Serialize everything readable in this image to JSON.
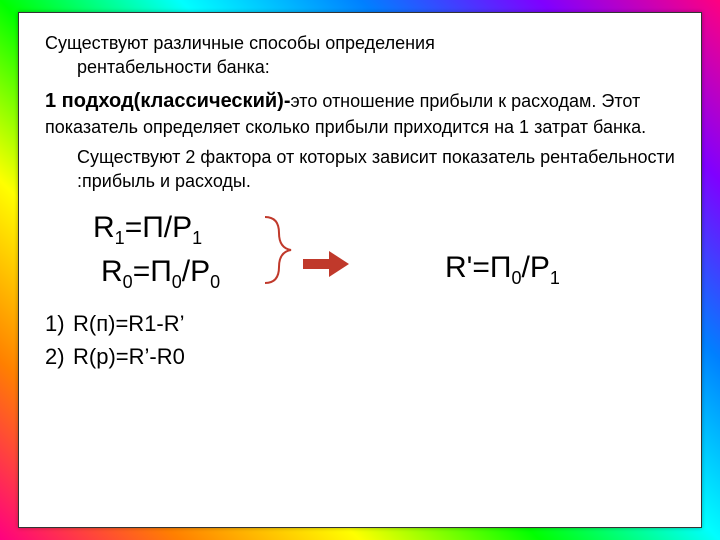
{
  "intro_line1": "Существуют различные способы определения",
  "intro_line2": "рентабельности банка:",
  "approach_bold": "1 подход(классический)-",
  "approach_rest": "это отношение прибыли к расходам. Этот показатель определяет сколько прибыли приходится на 1 затрат банка.",
  "factors": "Существуют 2 фактора от которых зависит  показатель рентабельности :прибыль и расходы.",
  "formula1_a": "R",
  "formula1_sub1": "1",
  "formula1_b": "=П/Р",
  "formula1_sub2": "1",
  "formula2_a": "R",
  "formula2_sub1": "0",
  "formula2_b": "=П",
  "formula2_sub2": "0",
  "formula2_c": "/Р",
  "formula2_sub3": "0",
  "formula3_a": "R'=П",
  "formula3_sub1": "0",
  "formula3_b": "/Р",
  "formula3_sub2": "1",
  "list1_num": "1)",
  "list1_txt": "R(п)=R1-R’",
  "list2_num": "2)",
  "list2_txt": "R(р)=R’-R0"
}
